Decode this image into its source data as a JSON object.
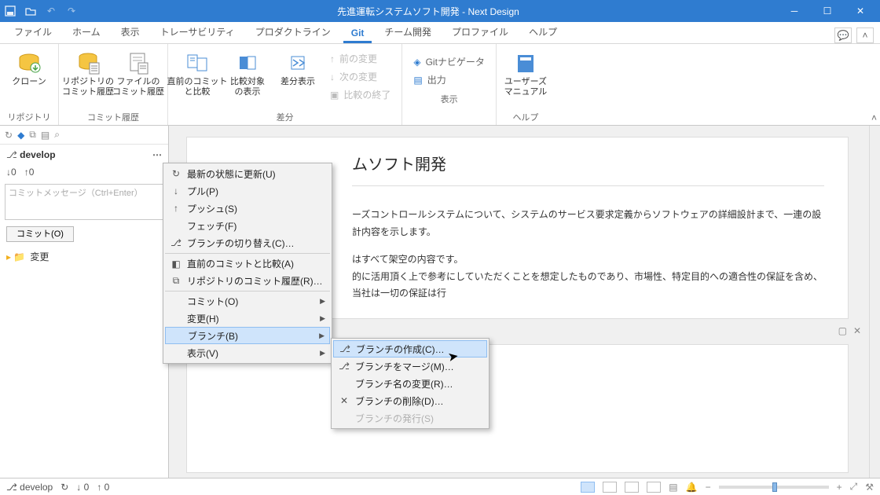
{
  "titlebar": {
    "title": "先進運転システムソフト開発 - Next Design"
  },
  "tabs": [
    "ファイル",
    "ホーム",
    "表示",
    "トレーサビリティ",
    "プロダクトライン",
    "Git",
    "チーム開発",
    "プロファイル",
    "ヘルプ"
  ],
  "active_tab_index": 5,
  "ribbon": {
    "groups": [
      {
        "label": "リポジトリ",
        "buttons": [
          {
            "label": "クローン"
          }
        ]
      },
      {
        "label": "コミット履歴",
        "buttons": [
          {
            "label": "リポジトリの\nコミット履歴"
          },
          {
            "label": "ファイルの\nコミット履歴"
          }
        ]
      },
      {
        "label": "差分",
        "buttons": [
          {
            "label": "直前のコミット\nと比較"
          },
          {
            "label": "比較対象\nの表示"
          },
          {
            "label": "差分表示"
          }
        ],
        "rows": [
          {
            "label": "前の変更",
            "dis": true
          },
          {
            "label": "次の変更",
            "dis": true
          },
          {
            "label": "比較の終了",
            "dis": true
          }
        ]
      },
      {
        "label": "表示",
        "rows": [
          {
            "label": "Gitナビゲータ"
          },
          {
            "label": "出力"
          }
        ]
      },
      {
        "label": "ヘルプ",
        "buttons": [
          {
            "label": "ユーザーズ\nマニュアル"
          }
        ]
      }
    ]
  },
  "left": {
    "branch": "develop",
    "down": "0",
    "up": "0",
    "commit_msg_placeholder": "コミットメッセージ（Ctrl+Enter）",
    "commit_btn": "コミット(O)",
    "changes": "変更"
  },
  "doc": {
    "title_suffix": "ムソフト開発",
    "p1": "ーズコントロールシステムについて、システムのサービス要求定義からソフトウェアの詳細設計まで、一連の設計内容を示します。",
    "p2": "はすべて架空の内容です。",
    "p3": "的に活用頂く上で参考にしていただくことを想定したものであり、市場性、特定目的への適合性の保証を含め、当社は一切の保証は行"
  },
  "context_menu": {
    "items": [
      {
        "icon": "↻",
        "label": "最新の状態に更新(U)"
      },
      {
        "icon": "↓",
        "label": "プル(P)"
      },
      {
        "icon": "↑",
        "label": "プッシュ(S)"
      },
      {
        "icon": "",
        "label": "フェッチ(F)"
      },
      {
        "icon": "⎇",
        "label": "ブランチの切り替え(C)…"
      },
      {
        "icon": "◧",
        "label": "直前のコミットと比較(A)",
        "sep": true
      },
      {
        "icon": "⧉",
        "label": "リポジトリのコミット履歴(R)…"
      },
      {
        "icon": "",
        "label": "コミット(O)",
        "arrow": true,
        "sep": true
      },
      {
        "icon": "",
        "label": "変更(H)",
        "arrow": true
      },
      {
        "icon": "",
        "label": "ブランチ(B)",
        "arrow": true,
        "hl": true
      },
      {
        "icon": "",
        "label": "表示(V)",
        "arrow": true
      }
    ]
  },
  "submenu": {
    "items": [
      {
        "icon": "⎇",
        "label": "ブランチの作成(C)…",
        "hl": true
      },
      {
        "icon": "⎇",
        "label": "ブランチをマージ(M)…"
      },
      {
        "icon": "",
        "label": "ブランチ名の変更(R)…"
      },
      {
        "icon": "✕",
        "label": "ブランチの削除(D)…"
      },
      {
        "icon": "",
        "label": "ブランチの発行(S)",
        "dis": true
      }
    ]
  },
  "status": {
    "branch": "develop",
    "sync": "↻",
    "down": "0",
    "up": "0"
  }
}
